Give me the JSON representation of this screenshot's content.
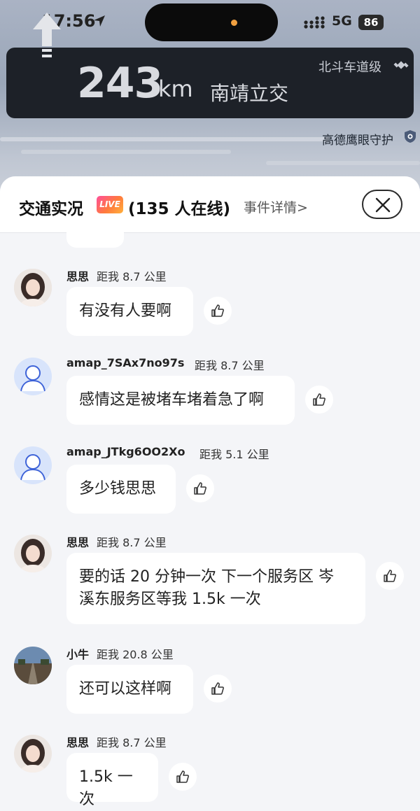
{
  "status_bar": {
    "time": "17:56",
    "network": "5G",
    "battery": "86"
  },
  "navigation": {
    "distance": "243",
    "unit": "km",
    "road": "南靖立交",
    "lane_level": "北斗车道级",
    "eagle_eye": "高德鹰眼守护"
  },
  "sheet": {
    "title": "交通实况",
    "live_badge": "LIVE",
    "online": "(135 人在线)",
    "event_details": "事件详情>"
  },
  "messages": [
    {
      "name": "思思",
      "distance": "距我 8.7 公里",
      "text": "有没有人要啊",
      "avatar": "girl-avatar"
    },
    {
      "name": "amap_7SAx7no97s",
      "distance": "距我 8.7 公里",
      "text": "感情这是被堵车堵着急了啊",
      "avatar": "default-avatar"
    },
    {
      "name": "amap_JTkg6OO2Xo",
      "distance": "距我 5.1 公里",
      "text": "多少钱思思",
      "avatar": "default-avatar"
    },
    {
      "name": "思思",
      "distance": "距我 8.7 公里",
      "text_line1": "要的话 20 分钟一次 下一个服务区 岑",
      "text_line2": "溪东服务区等我 1.5k 一次",
      "avatar": "girl-avatar"
    },
    {
      "name": "小牛",
      "distance": "距我 20.8 公里",
      "text": "还可以这样啊",
      "avatar": "road-avatar"
    },
    {
      "name": "思思",
      "distance": "距我 8.7 公里",
      "text": "1.5k 一次",
      "avatar": "girl-avatar"
    }
  ],
  "colors": {
    "nav_card": "#1d2128",
    "sheet_bg": "#f4f5f8",
    "live_gradient_start": "#ff4f9a",
    "live_gradient_end": "#ffb13b"
  }
}
